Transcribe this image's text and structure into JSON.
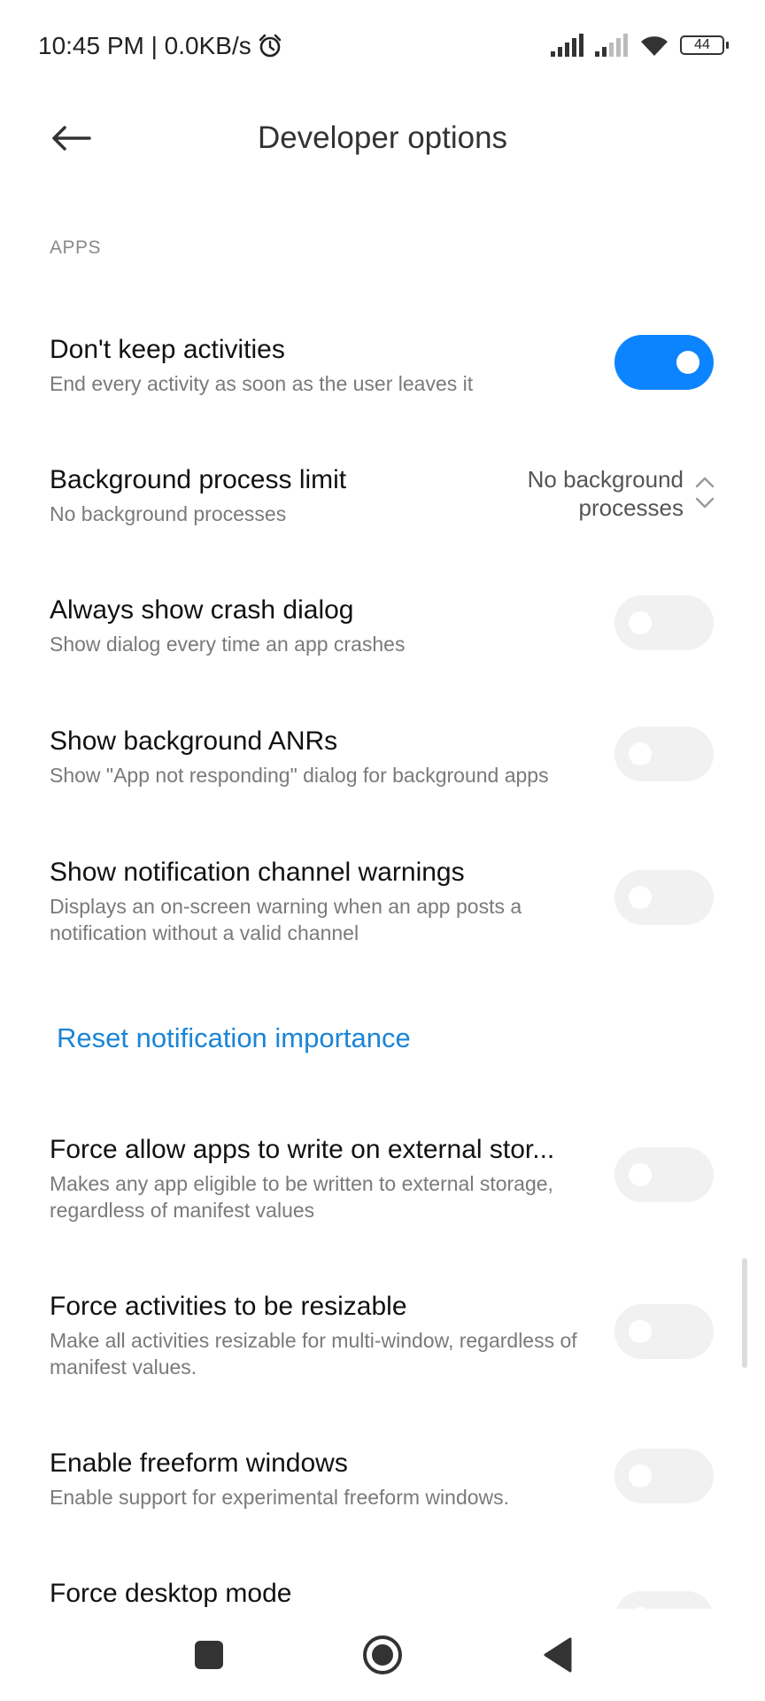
{
  "status_bar": {
    "time": "10:45 PM | 0.0KB/s",
    "battery": "44",
    "icons": [
      "alarm-icon",
      "signal-icon",
      "signal-icon",
      "wifi-icon",
      "battery-icon"
    ]
  },
  "header": {
    "title": "Developer options",
    "back_icon": "arrow-left-icon"
  },
  "section": {
    "label": "APPS"
  },
  "settings": [
    {
      "title": "Don't keep activities",
      "subtitle": "End every activity as soon as the user leaves it",
      "type": "toggle",
      "on": true
    },
    {
      "title": "Background process limit",
      "subtitle": "No background processes",
      "type": "select",
      "value_line1": "No background",
      "value_line2": "processes"
    },
    {
      "title": "Always show crash dialog",
      "subtitle": "Show dialog every time an app crashes",
      "type": "toggle",
      "on": false
    },
    {
      "title": "Show background ANRs",
      "subtitle": "Show \"App not responding\" dialog for background apps",
      "type": "toggle",
      "on": false
    },
    {
      "title": "Show notification channel warnings",
      "subtitle": "Displays an on-screen warning when an app posts a notification without a valid channel",
      "type": "toggle",
      "on": false
    },
    {
      "title": "Force allow apps to write on external stor...",
      "subtitle": "Makes any app eligible to be written to external storage, regardless of manifest values",
      "type": "toggle",
      "on": false
    },
    {
      "title": "Force activities to be resizable",
      "subtitle": "Make all activities resizable for multi-window, regardless of manifest values.",
      "type": "toggle",
      "on": false
    },
    {
      "title": "Enable freeform windows",
      "subtitle": "Enable support for experimental freeform windows.",
      "type": "toggle",
      "on": false
    },
    {
      "title": "Force desktop mode",
      "subtitle": "",
      "type": "toggle",
      "on": false
    }
  ],
  "link": {
    "label": "Reset notification importance"
  },
  "nav_bar": {
    "buttons": [
      "recents-square-icon",
      "home-circle-icon",
      "back-triangle-icon"
    ]
  },
  "colors": {
    "accent": "#0d84ff",
    "link": "#1a85d6",
    "toggle_off": "#f1f1f1"
  }
}
